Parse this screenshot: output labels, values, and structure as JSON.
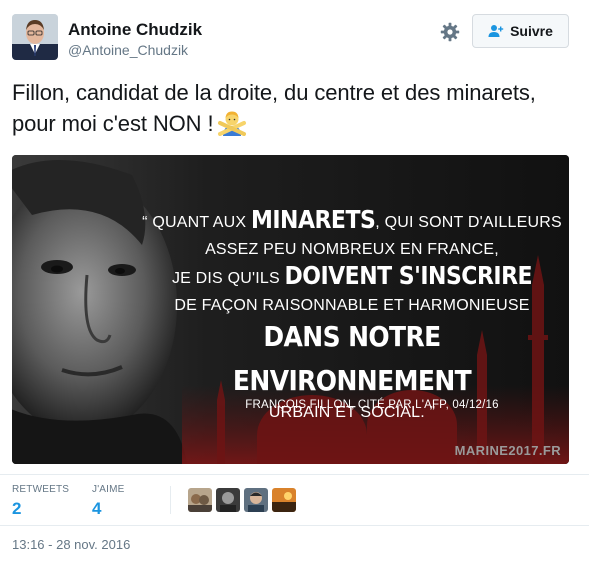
{
  "author": {
    "name": "Antoine Chudzik",
    "handle": "@Antoine_Chudzik"
  },
  "header": {
    "follow_label": "Suivre",
    "settings_icon": "gear-icon",
    "follow_icon": "add-person-icon"
  },
  "tweet": {
    "text": "Fillon, candidat de la droite, du centre et des minarets, pour moi c'est NON !",
    "emoji": "person-gesturing-no"
  },
  "media": {
    "quote_open": "“ QUANT AUX",
    "word_minarets": "MINARETS",
    "line1_end": ", QUI SONT D'AILLEURS",
    "line2": "ASSEZ PEU NOMBREUX EN FRANCE,",
    "line3_start": "JE DIS QU'ILS",
    "word_doivent": "DOIVENT S'INSCRIRE",
    "line4": "DE FAÇON RAISONNABLE ET HARMONIEUSE",
    "line5": "DANS NOTRE ENVIRONNEMENT",
    "line6": "URBAIN ET SOCIAL. ”",
    "attribution": "FRANÇOIS FILLON, CITÉ PAR L'AFP, 04/12/16",
    "watermark": "MARINE2017.FR"
  },
  "stats": {
    "retweets_label": "RETWEETS",
    "retweets_value": "2",
    "likes_label": "J'AIME",
    "likes_value": "4"
  },
  "likers": [
    "liker-1",
    "liker-2",
    "liker-3",
    "liker-4"
  ],
  "timestamp": "13:16 - 28 nov. 2016",
  "colors": {
    "link_blue": "#1b95e0",
    "muted": "#657786",
    "border": "#e6ecf0"
  }
}
